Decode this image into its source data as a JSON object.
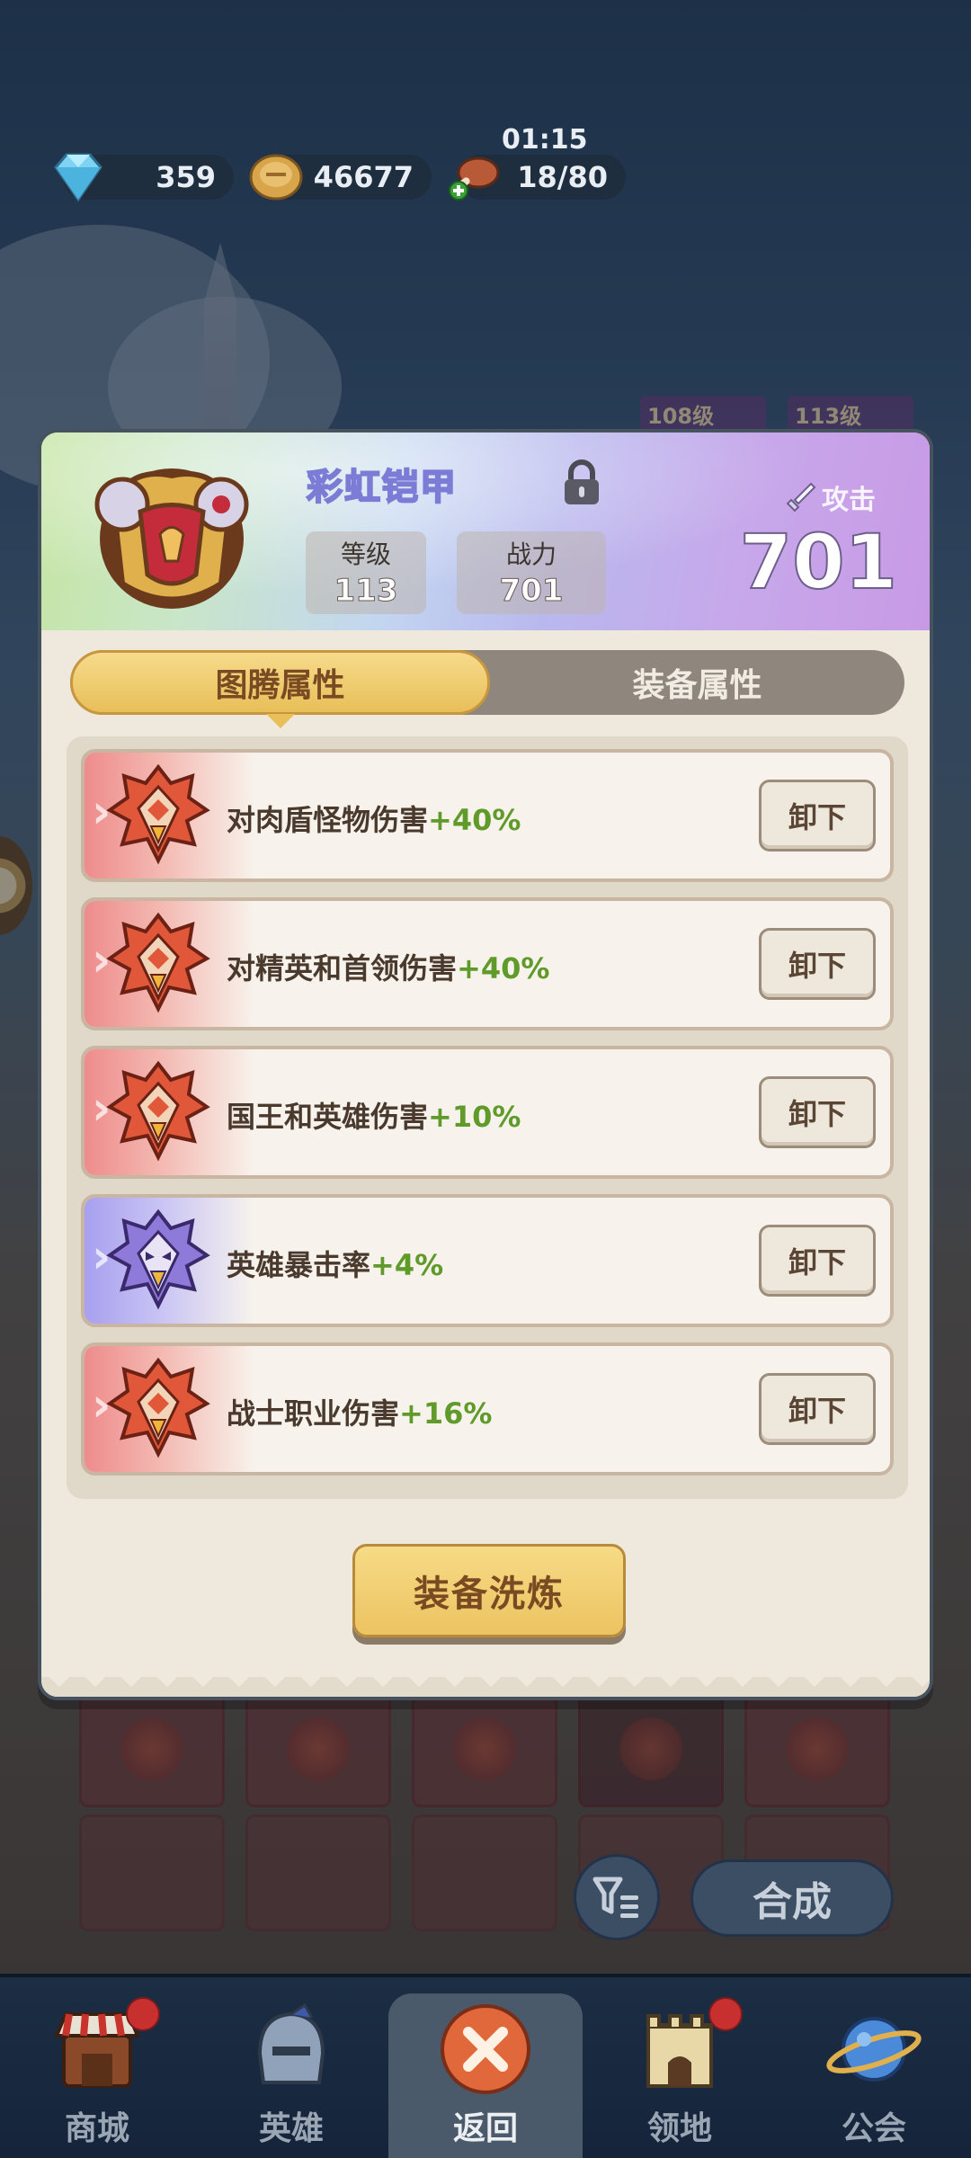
{
  "resources": {
    "gems": "359",
    "coins": "46677",
    "stamina": "18/80",
    "stamina_timer": "01:15"
  },
  "background": {
    "level_tags": [
      "108级",
      "113级"
    ]
  },
  "item": {
    "name": "彩虹铠甲",
    "level_label": "等级",
    "level_value": "113",
    "power_label": "战力",
    "power_value": "701",
    "attack_label": "攻击",
    "attack_value": "701"
  },
  "tabs": [
    {
      "label": "图腾属性",
      "active": true
    },
    {
      "label": "装备属性",
      "active": false
    }
  ],
  "attributes": [
    {
      "name": "对肉盾怪物伤害",
      "bonus": "+40%",
      "rarity": "red",
      "button": "卸下"
    },
    {
      "name": "对精英和首领伤害",
      "bonus": "+40%",
      "rarity": "red",
      "button": "卸下"
    },
    {
      "name": "国王和英雄伤害",
      "bonus": "+10%",
      "rarity": "red",
      "button": "卸下"
    },
    {
      "name": "英雄暴击率",
      "bonus": "+4%",
      "rarity": "purple",
      "button": "卸下"
    },
    {
      "name": "战士职业伤害",
      "bonus": "+16%",
      "rarity": "red",
      "button": "卸下"
    }
  ],
  "actions": {
    "reforge": "装备洗炼",
    "merge": "合成"
  },
  "nav": [
    {
      "label": "商城",
      "icon": "shop-icon",
      "badge": true
    },
    {
      "label": "英雄",
      "icon": "hero-helmet-icon",
      "badge": false
    },
    {
      "label": "返回",
      "icon": "close-icon",
      "badge": false
    },
    {
      "label": "领地",
      "icon": "castle-icon",
      "badge": true
    },
    {
      "label": "公会",
      "icon": "planet-icon",
      "badge": false
    }
  ],
  "colors": {
    "bonus_green": "#5f9a2a",
    "tab_active_gold": "#e8bf59",
    "badge_red": "#c8302f"
  }
}
